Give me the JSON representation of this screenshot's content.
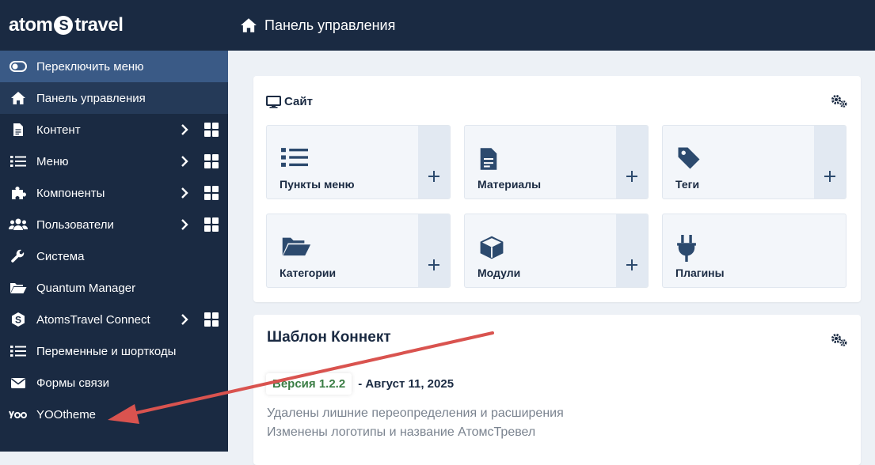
{
  "logo": {
    "left": "atom",
    "badge": "S",
    "right": "travel"
  },
  "header": {
    "title": "Панель управления"
  },
  "sidebar": {
    "items": [
      {
        "label": "Переключить меню",
        "icon": "toggle-icon"
      },
      {
        "label": "Панель управления",
        "icon": "home-icon"
      },
      {
        "label": "Контент",
        "icon": "file-icon"
      },
      {
        "label": "Меню",
        "icon": "list-icon"
      },
      {
        "label": "Компоненты",
        "icon": "puzzle-icon"
      },
      {
        "label": "Пользователи",
        "icon": "users-icon"
      },
      {
        "label": "Система",
        "icon": "wrench-icon"
      },
      {
        "label": "Quantum Manager",
        "icon": "folder-open-icon"
      },
      {
        "label": "AtomsTravel Connect",
        "icon": "atoms-logo-icon"
      },
      {
        "label": "Переменные и шорткоды",
        "icon": "list-icon"
      },
      {
        "label": "Формы связи",
        "icon": "envelope-icon"
      },
      {
        "label": "YOOtheme",
        "icon": "yoo-logo-icon"
      }
    ]
  },
  "site_card": {
    "title": "Сайт",
    "tiles": [
      {
        "label": "Пункты меню",
        "icon": "list-icon"
      },
      {
        "label": "Материалы",
        "icon": "file-icon"
      },
      {
        "label": "Теги",
        "icon": "tag-icon"
      },
      {
        "label": "Категории",
        "icon": "folder-open-icon"
      },
      {
        "label": "Модули",
        "icon": "cube-icon"
      },
      {
        "label": "Плагины",
        "icon": "plug-icon"
      }
    ],
    "add_symbol": "+"
  },
  "template_card": {
    "title": "Шаблон Коннект",
    "version": "Версия 1.2.2",
    "date": "- Август 11, 2025",
    "changes": [
      "Удалены лишние переопределения и расширения",
      "Изменены логотипы и название АтомсТревел"
    ]
  },
  "colors": {
    "sidebar_bg": "#1a2a42",
    "active_bg": "#253a58",
    "toggle_bg": "#3a5a86",
    "content_bg": "#edf1f6",
    "version_green": "#3a7d44",
    "annotation_arrow": "#d9534f"
  }
}
